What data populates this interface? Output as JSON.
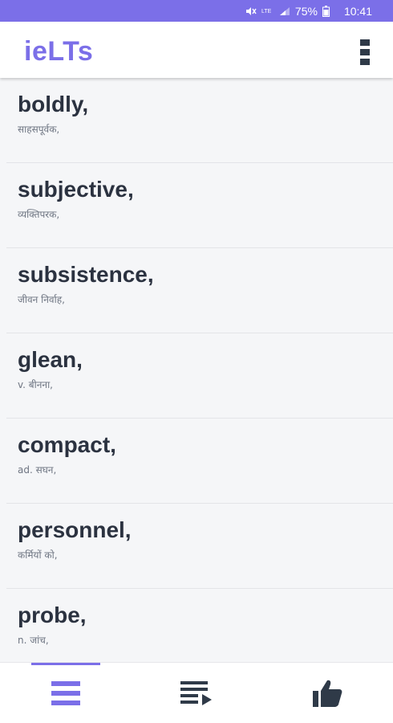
{
  "status_bar": {
    "time": "10:41",
    "battery": "75%",
    "network": "LTE",
    "icons": [
      "mute-icon",
      "lte-icon",
      "signal-icon",
      "battery-icon"
    ]
  },
  "app_bar": {
    "title": "ieLTs",
    "menu_icon": "overflow-menu-icon"
  },
  "colors": {
    "accent": "#7b6fe8",
    "text_dark": "#2b3240",
    "text_muted": "#6e7582",
    "list_bg": "#f5f6f8"
  },
  "words": [
    {
      "word": "boldly,",
      "meaning": "साहसपूर्वक,"
    },
    {
      "word": "subjective,",
      "meaning": "व्यक्तिपरक,"
    },
    {
      "word": "subsistence,",
      "meaning": "जीवन निर्वाह,"
    },
    {
      "word": "glean,",
      "meaning": "v. बीनना,"
    },
    {
      "word": "compact,",
      "meaning": "ad. सघन,"
    },
    {
      "word": "personnel,",
      "meaning": "कर्मियों को,"
    },
    {
      "word": "probe,",
      "meaning": "n. जांच,"
    }
  ],
  "bottom_nav": {
    "items": [
      {
        "icon": "list-icon",
        "active": true
      },
      {
        "icon": "playlist-play-icon",
        "active": false
      },
      {
        "icon": "thumbs-up-icon",
        "active": false
      }
    ]
  }
}
